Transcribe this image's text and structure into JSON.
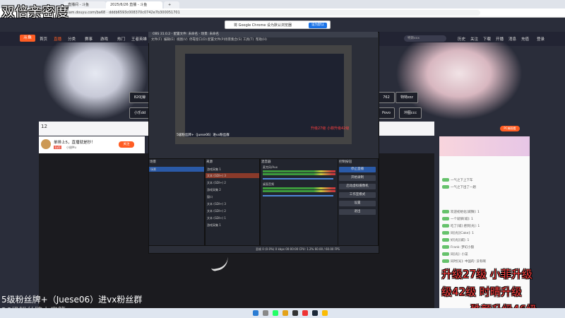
{
  "browser": {
    "tabs": [
      "直播间 - 斗鱼",
      "2025/6/26 直播 - 斗鱼",
      "新标签页"
    ],
    "url": "stream.douyu.com/ba68 · dddb6593c008370c0742e7b300051701",
    "chrome_prompt": "将 Google Chrome 设为默认浏览器",
    "chrome_prompt_button": "设为默认"
  },
  "site": {
    "logo": "斗鱼",
    "nav": [
      "首页",
      "直播",
      "分类",
      "赛事",
      "游戏",
      "热门",
      "王者英雄"
    ],
    "search_placeholder": "特斯xxx",
    "header_icons": [
      "历史",
      "关注",
      "下载",
      "开播",
      "消息",
      "充值",
      "登录"
    ]
  },
  "gifts": [
    "820[鲸",
    "小乐dd",
    "762",
    "特特zzz",
    "Povo",
    "冲图ccc"
  ],
  "room": {
    "fans": "12",
    "title": "单排上5，直播就是秒！",
    "level": "Lv1",
    "owner": "小翅Mu",
    "follow_label": "关注",
    "pc_label": "PC端观看"
  },
  "obs": {
    "title": "OBS 31.0.2 - 配置文件: 未命名 - 场景: 未命名",
    "menu": [
      "文件(F)",
      "编辑(E)",
      "视图(V)",
      "停靠窗口(D)",
      "配置文件(P)",
      "场景集合(S)",
      "工具(T)",
      "帮助(H)"
    ],
    "preview_overlay": "5级粉丝牌+（Juese06）进vx粉丝群",
    "preview_side": "升级27级 小菲升级42级",
    "scenes_title": "场景",
    "scenes": [
      "场景"
    ],
    "sources_title": "来源",
    "sources": [
      "游戏采集 1",
      "文本 (GDI+) 3",
      "文本 (GDI+) 2",
      "游戏采集 2",
      "窗口",
      "文本 (GDI+) 3",
      "文本 (GDI+) 2",
      "文本 (GDI+) 1",
      "游戏采集 1"
    ],
    "mixer_title": "混音器",
    "mixer": [
      "麦克风/Aux",
      "桌面音频"
    ],
    "controls_title": "控制按钮",
    "controls": [
      "停止直播",
      "开始录制",
      "启动虚拟摄像机",
      "工作室模式",
      "设置",
      "退出"
    ],
    "status": "丢帧 0 (0.0%)   0 kbps   00:00:00   CPU: 1.2%   60.00 / 60.00 FPS"
  },
  "chat": [
    "一气之下上下车",
    "一气之下出了一趟",
    "欢迎初始化[城镇]: 1",
    "一个就够[城]: 1",
    "吃了[城] 感到[光]: 1",
    "同[光][Cake]: 1",
    "好[光][城]: 1",
    "Frank: 梦幻小狼",
    "同[光]: 小菜",
    "同时[光]: 中国的: 没有啊"
  ],
  "overlays": {
    "top_left": "双倍亲密度",
    "bottom_left_1": "5级粉丝牌+（Juese06）进vx粉丝群",
    "bottom_left_2": "26级粉丝牌上房管",
    "right_1": "升级27级 小菲升级",
    "right_2": "级42级 时晴升级",
    "right_3": "殊颜升级46级"
  },
  "colors": {
    "accent": "#ff5d23",
    "obs_blue": "#2a5aa8",
    "overlay_red": "#ff4040"
  }
}
